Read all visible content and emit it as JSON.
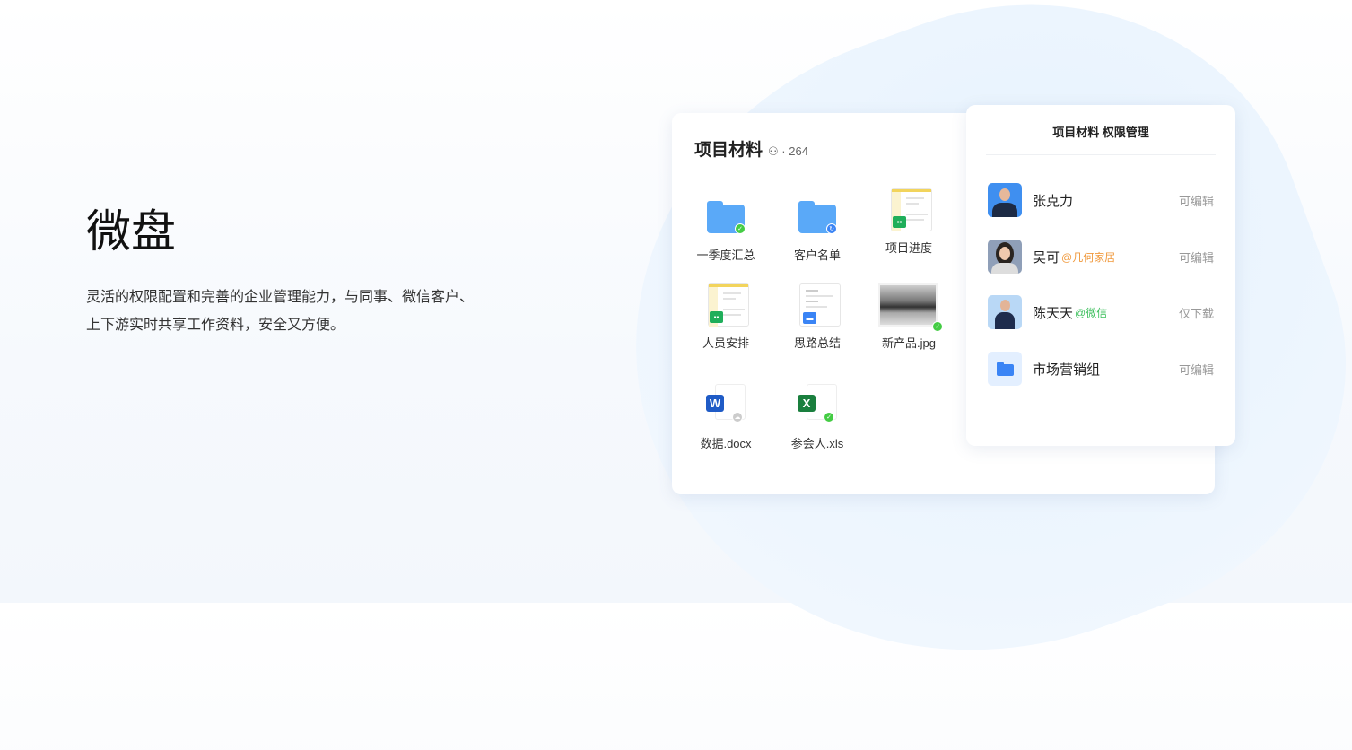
{
  "hero": {
    "title": "微盘",
    "description_line1": "灵活的权限配置和完善的企业管理能力，与同事、微信客户、",
    "description_line2": "上下游实时共享工作资料，安全又方便。"
  },
  "files_card": {
    "title": "项目材料",
    "member_count": "· 264",
    "items": [
      {
        "label": "一季度汇总",
        "type": "folder",
        "status": "synced"
      },
      {
        "label": "客户名单",
        "type": "folder",
        "status": "syncing"
      },
      {
        "label": "项目进度",
        "type": "sheet"
      },
      {
        "label": "人员安排",
        "type": "sheet"
      },
      {
        "label": "思路总结",
        "type": "doc"
      },
      {
        "label": "新产品.jpg",
        "type": "image",
        "status": "synced"
      },
      {
        "label": "数据.docx",
        "type": "word",
        "icon_letter": "W",
        "status": "cloud"
      },
      {
        "label": "参会人.xls",
        "type": "excel",
        "icon_letter": "X",
        "status": "synced"
      }
    ]
  },
  "perm_card": {
    "title": "项目材料 权限管理",
    "rows": [
      {
        "name": "张克力",
        "org": "",
        "permission": "可编辑"
      },
      {
        "name": "吴可",
        "org": "@几何家居",
        "permission": "可编辑"
      },
      {
        "name": "陈天天",
        "org": "@微信",
        "permission": "仅下载"
      },
      {
        "name": "市场营销组",
        "org": "",
        "permission": "可编辑"
      }
    ]
  },
  "colors": {
    "accent": "#3a84f5",
    "orange": "#f09a3e",
    "green": "#3cbf5c"
  }
}
